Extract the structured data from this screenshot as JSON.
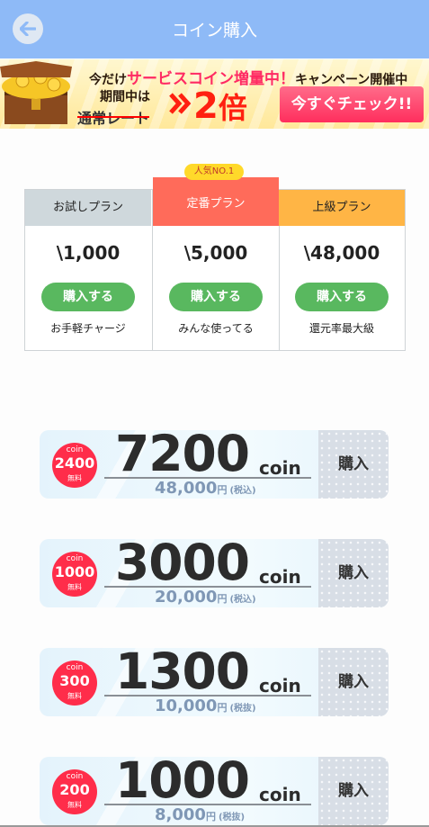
{
  "header": {
    "title": "コイン購入"
  },
  "banner": {
    "line1_prefix": "今だけ",
    "line1_highlight": "サービスコイン増量中！",
    "line1_suffix": "キャンペーン開催中",
    "line2": "期間中は",
    "line3": "通常レート",
    "big_number": "2",
    "big_unit": "倍",
    "cta": "今すぐチェック!!"
  },
  "badge": "人気NO.1",
  "plans": [
    {
      "name": "お試しプラン",
      "price": "\\1,000",
      "button": "購入する",
      "desc": "お手軽チャージ"
    },
    {
      "name": "定番プラン",
      "price": "\\5,000",
      "button": "購入する",
      "desc": "みんな使ってる"
    },
    {
      "name": "上級プラン",
      "price": "\\48,000",
      "button": "購入する",
      "desc": "還元率最大級"
    }
  ],
  "coins": [
    {
      "bonus_label": "coin",
      "bonus": "2400",
      "free": "無料",
      "amount": "7200",
      "unit": "coin",
      "price": "48,000",
      "yen": "円",
      "tax": "(税込)",
      "buy": "購入"
    },
    {
      "bonus_label": "coin",
      "bonus": "1000",
      "free": "無料",
      "amount": "3000",
      "unit": "coin",
      "price": "20,000",
      "yen": "円",
      "tax": "(税込)",
      "buy": "購入"
    },
    {
      "bonus_label": "coin",
      "bonus": "300",
      "free": "無料",
      "amount": "1300",
      "unit": "coin",
      "price": "10,000",
      "yen": "円",
      "tax": "(税抜)",
      "buy": "購入"
    },
    {
      "bonus_label": "coin",
      "bonus": "200",
      "free": "無料",
      "amount": "1000",
      "unit": "coin",
      "price": "8,000",
      "yen": "円",
      "tax": "(税抜)",
      "buy": "購入"
    }
  ],
  "colors": {
    "header": "#8ebaf7",
    "accent_red": "#ff2d4a",
    "green": "#59b85f",
    "orange": "#ffb545"
  }
}
